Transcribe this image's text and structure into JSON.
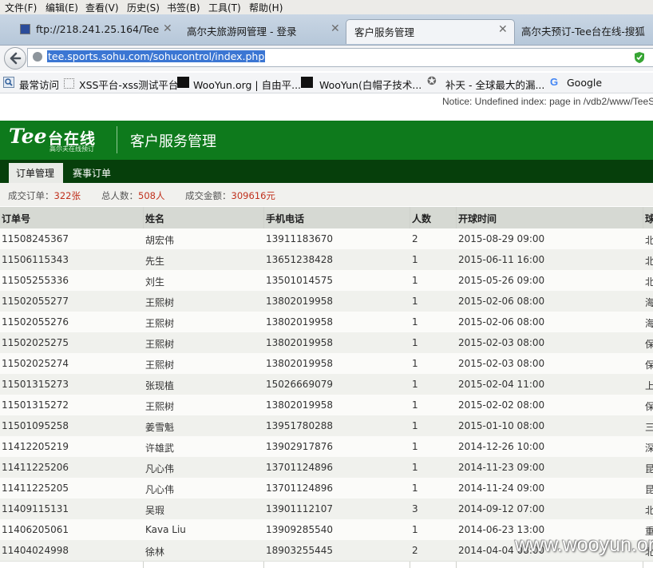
{
  "menu": [
    "文件(F)",
    "编辑(E)",
    "查看(V)",
    "历史(S)",
    "书签(B)",
    "工具(T)",
    "帮助(H)"
  ],
  "tabs": [
    {
      "title": "ftp://218.241.25.164/Tee..."
    },
    {
      "title": "高尔夫旅游网管理 - 登录"
    },
    {
      "title": "客户服务管理"
    },
    {
      "title": "高尔夫预订-Tee台在线-搜狐"
    }
  ],
  "url": "tee.sports.sohu.com/sohucontrol/index.php",
  "bookmarks": [
    "最常访问",
    "XSS平台-xss测试平台",
    "WooYun.org | 自由平...",
    "WooYun(白帽子技术...",
    "补天 - 全球最大的漏...",
    "Google"
  ],
  "notice": "Notice: Undefined index: page in /vdb2/www/TeeS",
  "site": {
    "logo": "Tee",
    "logo_cn": "台在线",
    "logo_sub": "高尔夫在线预订",
    "title": "客户服务管理"
  },
  "nav": {
    "orders": "订单管理",
    "events": "赛事订单"
  },
  "summary": {
    "orders_label": "成交订单：",
    "orders_value": "322张",
    "people_label": "总人数：",
    "people_value": "508人",
    "amount_label": "成交金额：",
    "amount_value": "309616元"
  },
  "table": {
    "headers": [
      "订单号",
      "姓名",
      "手机电话",
      "人数",
      "开球时间",
      "球"
    ],
    "rows": [
      [
        "11508245367",
        "胡宏伟",
        "13911183670",
        "2",
        "2015-08-29 09:00",
        "北"
      ],
      [
        "11506115343",
        "先生",
        "13651238428",
        "1",
        "2015-06-11 16:00",
        "北"
      ],
      [
        "11505255336",
        "刘生",
        "13501014575",
        "1",
        "2015-05-26 09:00",
        "北"
      ],
      [
        "11502055277",
        "王熙树",
        "13802019958",
        "1",
        "2015-02-06 08:00",
        "海"
      ],
      [
        "11502055276",
        "王熙树",
        "13802019958",
        "1",
        "2015-02-06 08:00",
        "海"
      ],
      [
        "11502025275",
        "王熙树",
        "13802019958",
        "1",
        "2015-02-03 08:00",
        "保"
      ],
      [
        "11502025274",
        "王熙树",
        "13802019958",
        "1",
        "2015-02-03 08:00",
        "保"
      ],
      [
        "11501315273",
        "张现植",
        "15026669079",
        "1",
        "2015-02-04 11:00",
        "上"
      ],
      [
        "11501315272",
        "王熙树",
        "13802019958",
        "1",
        "2015-02-02 08:00",
        "保"
      ],
      [
        "11501095258",
        "姜雪魁",
        "13951780288",
        "1",
        "2015-01-10 08:00",
        "三"
      ],
      [
        "11412205219",
        "许雄武",
        "13902917876",
        "1",
        "2014-12-26 10:00",
        "深"
      ],
      [
        "11411225206",
        "凡心伟",
        "13701124896",
        "1",
        "2014-11-23 09:00",
        "昆"
      ],
      [
        "11411225205",
        "凡心伟",
        "13701124896",
        "1",
        "2014-11-24 09:00",
        "昆"
      ],
      [
        "11409115131",
        "吴瑕",
        "13901112107",
        "3",
        "2014-09-12 07:00",
        "北"
      ],
      [
        "11406205061",
        "Kava Liu",
        "13909285540",
        "1",
        "2014-06-23 13:00",
        "重"
      ],
      [
        "11404024998",
        "徐林",
        "18903255445",
        "2",
        "2014-04-04 08:00",
        "北"
      ]
    ]
  },
  "watermark": "www.wooyun.org"
}
